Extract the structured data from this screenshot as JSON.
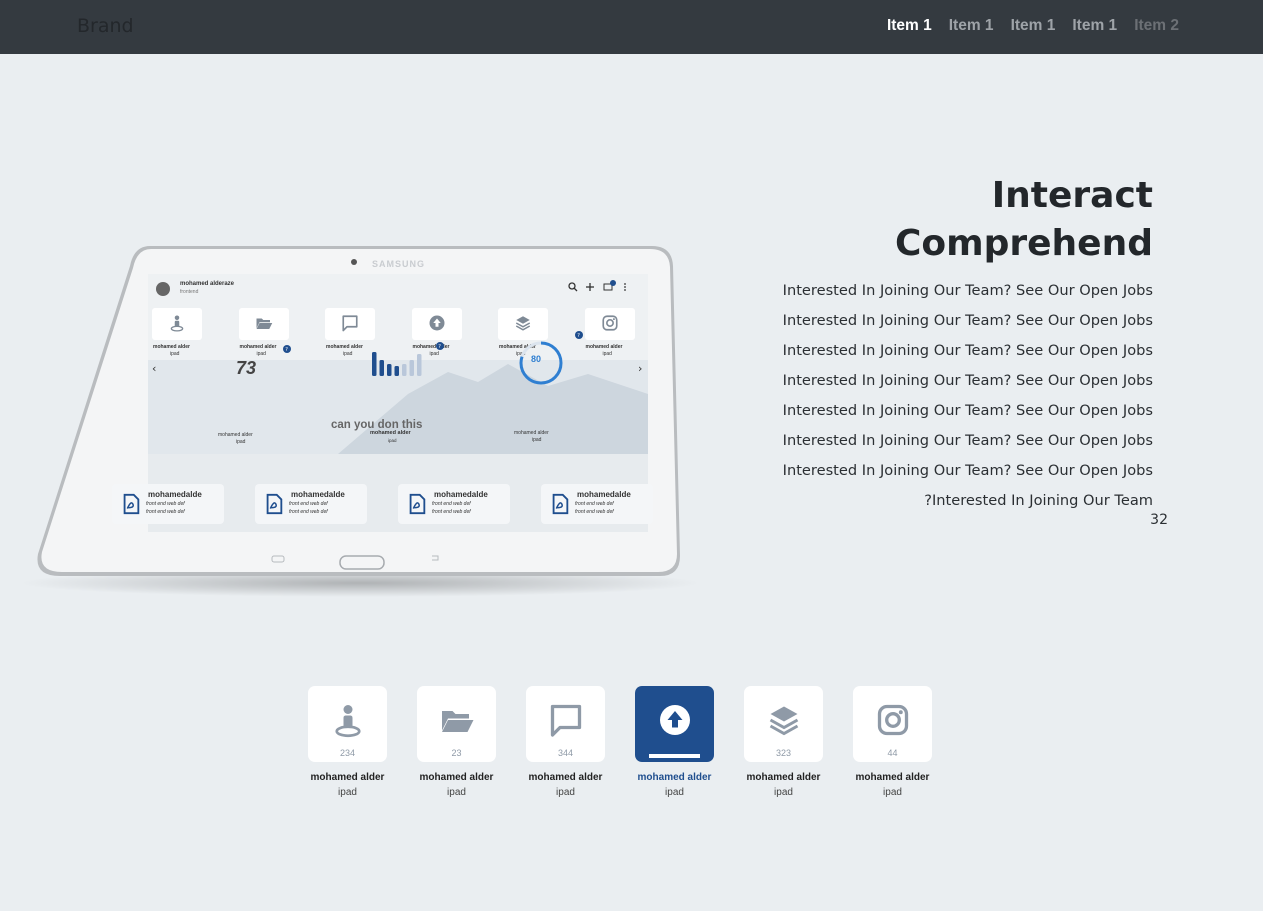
{
  "navbar": {
    "brand": "Brand",
    "items": [
      {
        "label": "Item 1",
        "state": "active"
      },
      {
        "label": "Item 1",
        "state": "normal"
      },
      {
        "label": "Item 1",
        "state": "normal"
      },
      {
        "label": "Item 1",
        "state": "normal"
      },
      {
        "label": "Item 2",
        "state": "disabled"
      }
    ]
  },
  "hero": {
    "title_line1": "Interact",
    "title_line2": "Comprehend",
    "lines": [
      "Interested In Joining Our Team? See Our Open Jobs",
      "Interested In Joining Our Team? See Our Open Jobs",
      "Interested In Joining Our Team? See Our Open Jobs",
      "Interested In Joining Our Team? See Our Open Jobs",
      "Interested In Joining Our Team? See Our Open Jobs",
      "Interested In Joining Our Team? See Our Open Jobs",
      "Interested In Joining Our Team? See Our Open Jobs",
      "?Interested In Joining Our Team"
    ],
    "number": "32"
  },
  "tablet": {
    "brand": "SAMSUNG",
    "user_name": "mohamed alderaze",
    "user_role": "frontend",
    "notification_count": "1",
    "apps": [
      {
        "icon": "person-pin-icon",
        "label": "mohamed alder",
        "sub": "ipad"
      },
      {
        "icon": "folder-open-icon",
        "label": "mohamed alder",
        "sub": "ipad"
      },
      {
        "icon": "chat-icon",
        "label": "mohamed alder",
        "sub": "ipad"
      },
      {
        "icon": "upload-icon",
        "label": "mohamed alder",
        "sub": "ipad"
      },
      {
        "icon": "layers-icon",
        "label": "mohamed alder",
        "sub": "ipad"
      },
      {
        "icon": "instagram-icon",
        "label": "mohamed alder",
        "sub": "ipad"
      }
    ],
    "stat_number": "73",
    "stat_number_label": "mohamed alder",
    "stat_number_sub": "ipad",
    "bars_label": "mohamed alder",
    "bars_sub": "ipad",
    "ring_value": 80,
    "ring_label": "mohamed alder",
    "ring_sub": "ipad",
    "caption": "can you don this",
    "files": [
      {
        "title": "mohamedalde",
        "line1": "front end web def",
        "line2": "front end web def"
      },
      {
        "title": "mohamedalde",
        "line1": "front end web def",
        "line2": "front end web def"
      },
      {
        "title": "mohamedalde",
        "line1": "front end web def",
        "line2": "front end web def"
      },
      {
        "title": "mohamedalde",
        "line1": "front end web def",
        "line2": "front end web def"
      }
    ]
  },
  "tiles": [
    {
      "icon": "person-pin-icon",
      "count": "234",
      "label": "mohamed alder",
      "sub": "ipad",
      "active": false
    },
    {
      "icon": "folder-open-icon",
      "count": "23",
      "label": "mohamed alder",
      "sub": "ipad",
      "active": false
    },
    {
      "icon": "chat-icon",
      "count": "344",
      "label": "mohamed alder",
      "sub": "ipad",
      "active": false
    },
    {
      "icon": "upload-icon",
      "count": "",
      "label": "mohamed alder",
      "sub": "ipad",
      "active": true
    },
    {
      "icon": "layers-icon",
      "count": "323",
      "label": "mohamed alder",
      "sub": "ipad",
      "active": false
    },
    {
      "icon": "instagram-icon",
      "count": "44",
      "label": "mohamed alder",
      "sub": "ipad",
      "active": false
    }
  ],
  "colors": {
    "navbar": "#343a40",
    "background": "#eaeef1",
    "accent": "#1f4e8e",
    "icon": "#8f9aa7",
    "ring": "#2f7fd1"
  }
}
